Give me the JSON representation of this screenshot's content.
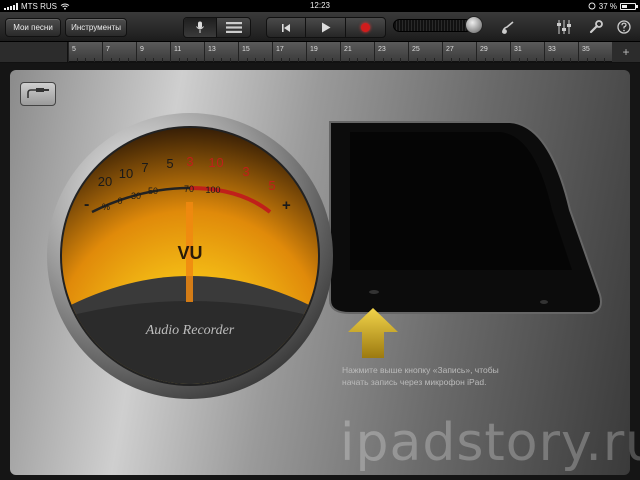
{
  "status_bar": {
    "carrier": "MTS RUS",
    "time": "12:23",
    "battery": "37 %"
  },
  "toolbar": {
    "my_songs_label": "Мои песни",
    "instruments_label": "Инструменты",
    "view_toggle": {
      "selected": "mic-view"
    },
    "transport": [
      "rewind-icon",
      "play-icon",
      "record-icon"
    ],
    "icons": [
      "metronome-icon",
      "mixer-icon",
      "wrench-icon",
      "help-icon"
    ]
  },
  "ruler": {
    "marks": [
      "5",
      "7",
      "9",
      "11",
      "13",
      "15",
      "17",
      "19",
      "21",
      "23",
      "25",
      "27",
      "29",
      "31",
      "33",
      "35"
    ],
    "add_label": "+"
  },
  "vu_meter": {
    "scale_top": [
      "20",
      "10",
      "7",
      "5",
      "3",
      "1",
      "0",
      "3",
      "5"
    ],
    "scale_bottom": [
      "%",
      "0",
      "30",
      "50",
      "70",
      "100"
    ],
    "minus": "-",
    "plus": "+",
    "vu_label": "VU",
    "brand": "Audio Recorder"
  },
  "hint": {
    "line1": "Нажмите выше кнопку «Запись», чтобы",
    "line2": "начать запись через микрофон iPad."
  },
  "watermark": "ipadstory.ru",
  "colors": {
    "record": "#d11c1c",
    "meter_amber": "#f5a40a",
    "meter_red": "#c0201a",
    "arrow_yellow": "#e8c01c"
  }
}
